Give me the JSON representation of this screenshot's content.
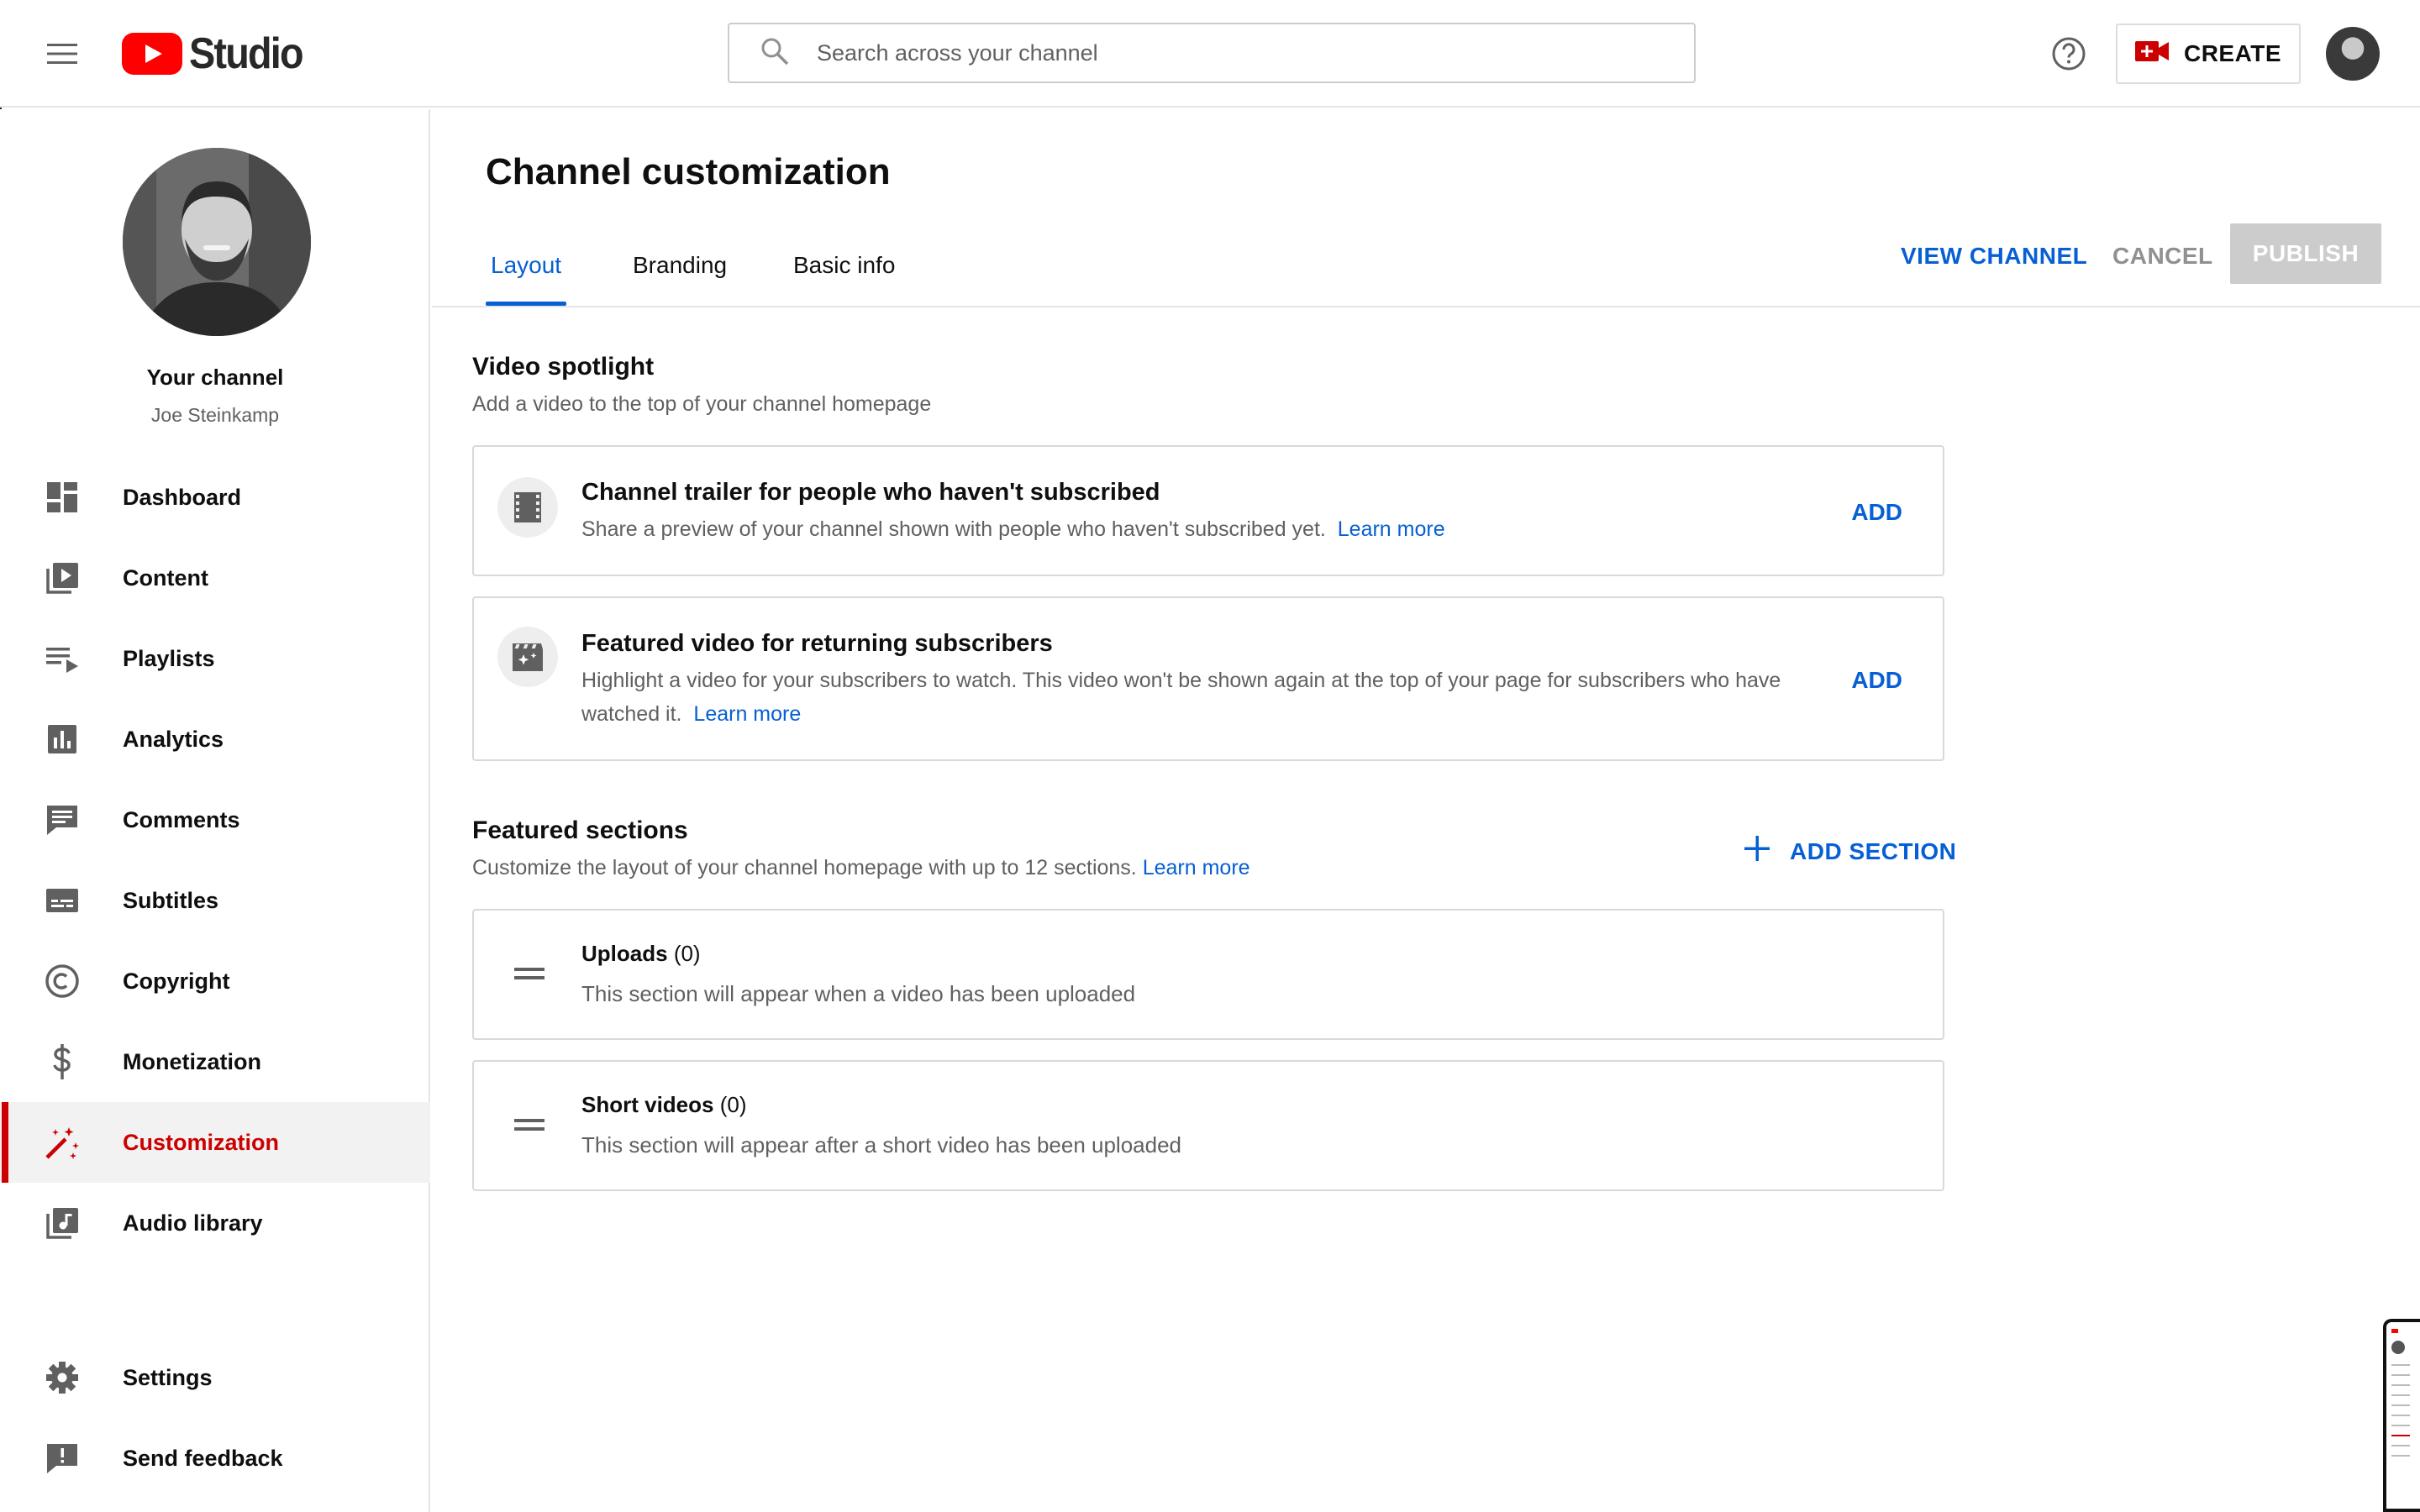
{
  "app": {
    "logo_text": "Studio",
    "search_placeholder": "Search across your channel",
    "create_label": "CREATE"
  },
  "sidebar": {
    "your_channel": "Your channel",
    "channel_name": "Joe Steinkamp",
    "items": [
      {
        "label": "Dashboard",
        "icon": "dashboard-icon"
      },
      {
        "label": "Content",
        "icon": "content-icon"
      },
      {
        "label": "Playlists",
        "icon": "playlists-icon"
      },
      {
        "label": "Analytics",
        "icon": "analytics-icon"
      },
      {
        "label": "Comments",
        "icon": "comments-icon"
      },
      {
        "label": "Subtitles",
        "icon": "subtitles-icon"
      },
      {
        "label": "Copyright",
        "icon": "copyright-icon"
      },
      {
        "label": "Monetization",
        "icon": "dollar-icon"
      },
      {
        "label": "Customization",
        "icon": "magic-wand-icon",
        "active": true
      },
      {
        "label": "Audio library",
        "icon": "audio-library-icon"
      }
    ],
    "bottom_items": [
      {
        "label": "Settings",
        "icon": "gear-icon"
      },
      {
        "label": "Send feedback",
        "icon": "feedback-icon"
      }
    ]
  },
  "main": {
    "title": "Channel customization",
    "tabs": [
      "Layout",
      "Branding",
      "Basic info"
    ],
    "active_tab": "Layout",
    "actions": {
      "view_channel": "VIEW CHANNEL",
      "cancel": "CANCEL",
      "publish": "PUBLISH"
    },
    "video_spotlight": {
      "title": "Video spotlight",
      "subtitle": "Add a video to the top of your channel homepage",
      "cards": [
        {
          "title": "Channel trailer for people who haven't subscribed",
          "description": "Share a preview of your channel shown with people who haven't subscribed yet.",
          "link": "Learn more",
          "action": "ADD",
          "icon": "film-icon"
        },
        {
          "title": "Featured video for returning subscribers",
          "description": "Highlight a video for your subscribers to watch. This video won't be shown again at the top of your page for subscribers who have watched it.",
          "link": "Learn more",
          "action": "ADD",
          "icon": "sparkle-clapper-icon"
        }
      ]
    },
    "featured_sections": {
      "title": "Featured sections",
      "subtitle": "Customize the layout of your channel homepage with up to 12 sections.",
      "link": "Learn more",
      "add_section": "ADD SECTION",
      "items": [
        {
          "name": "Uploads",
          "count": "(0)",
          "description": "This section will appear when a video has been uploaded"
        },
        {
          "name": "Short videos",
          "count": "(0)",
          "description": "This section will appear after a short video has been uploaded"
        }
      ]
    }
  },
  "colors": {
    "accent": "#065fd4",
    "brand_red": "#ff0000",
    "active_red": "#cc0000",
    "disabled": "#cccccc"
  }
}
